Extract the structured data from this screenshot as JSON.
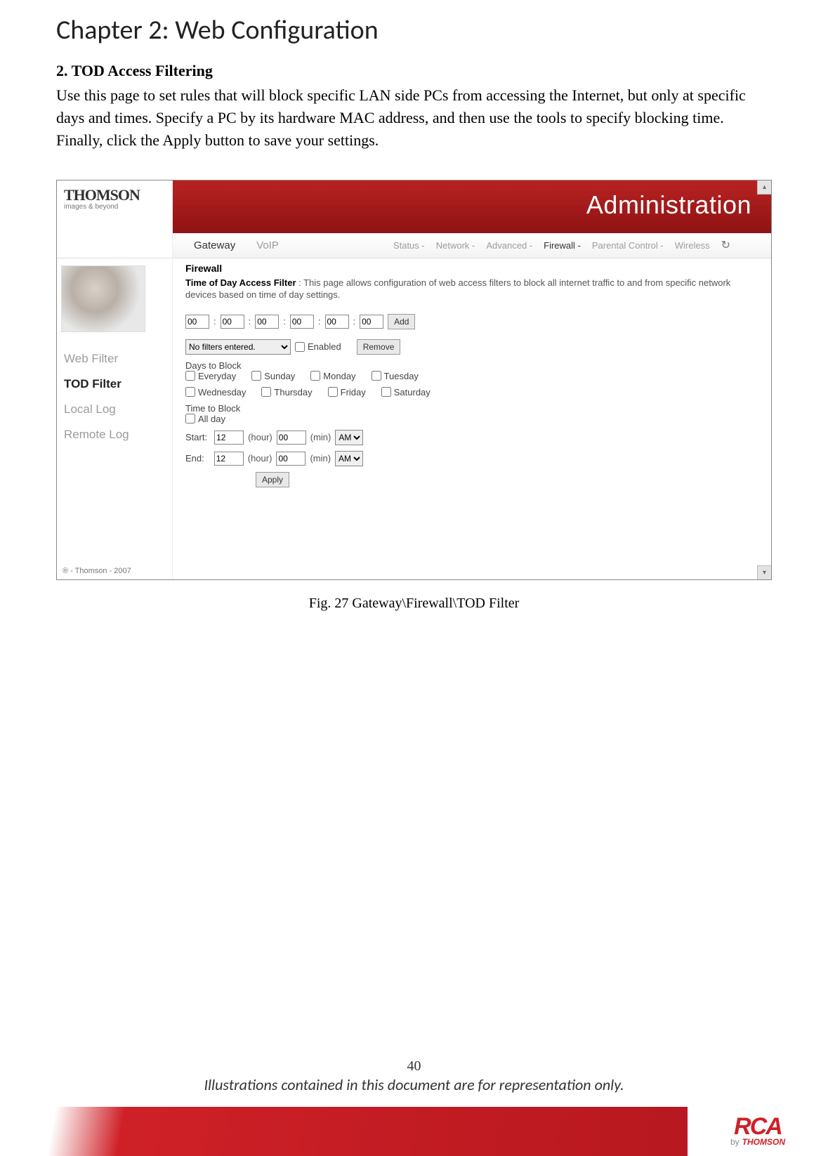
{
  "chapter_title": "Chapter 2: Web Configuration",
  "section_title": "2. TOD Access Filtering",
  "section_body": "Use this page to set rules that will block specific LAN side PCs from accessing the Internet, but only at specific days and times. Specify a PC by its hardware MAC address, and then use the tools to specify blocking time. Finally, click the Apply button to save your settings.",
  "figure_caption": "Fig. 27 Gateway\\Firewall\\TOD Filter",
  "page_number": "40",
  "footer_note": "Illustrations contained in this document are for representation only.",
  "screenshot": {
    "logo_brand": "THOMSON",
    "logo_tagline": "images & beyond",
    "header_title": "Administration",
    "main_tabs": {
      "gateway": "Gateway",
      "voip": "VoIP"
    },
    "sub_tabs": {
      "status": "Status -",
      "network": "Network -",
      "advanced": "Advanced -",
      "firewall": "Firewall -",
      "parental": "Parental Control -",
      "wireless": "Wireless"
    },
    "side_items": {
      "web_filter": "Web Filter",
      "tod_filter": "TOD Filter",
      "local_log": "Local Log",
      "remote_log": "Remote Log"
    },
    "side_footer": "® - Thomson - 2007",
    "panel_title": "Firewall",
    "panel_desc_label": "Time of Day Access Filter",
    "panel_desc": " :  This page allows configuration of web access filters to block all internet traffic to and from specific network devices based on time of day settings.",
    "mac": {
      "a": "00",
      "b": "00",
      "c": "00",
      "d": "00",
      "e": "00",
      "f": "00"
    },
    "add_label": "Add",
    "filter_select": "No filters entered.",
    "enabled_label": "Enabled",
    "remove_label": "Remove",
    "days_label": "Days to Block",
    "days": {
      "everyday": "Everyday",
      "sunday": "Sunday",
      "monday": "Monday",
      "tuesday": "Tuesday",
      "wednesday": "Wednesday",
      "thursday": "Thursday",
      "friday": "Friday",
      "saturday": "Saturday"
    },
    "time_label": "Time to Block",
    "all_day": "All day",
    "start_label": "Start:",
    "end_label": "End:",
    "hour_unit": "(hour)",
    "min_unit": "(min)",
    "start_hour": "12",
    "start_min": "00",
    "start_ampm": "AM",
    "end_hour": "12",
    "end_min": "00",
    "end_ampm": "AM",
    "apply_label": "Apply"
  },
  "footer_logo": {
    "rca": "RCA",
    "by": "by",
    "thomson": "THOMSON"
  }
}
